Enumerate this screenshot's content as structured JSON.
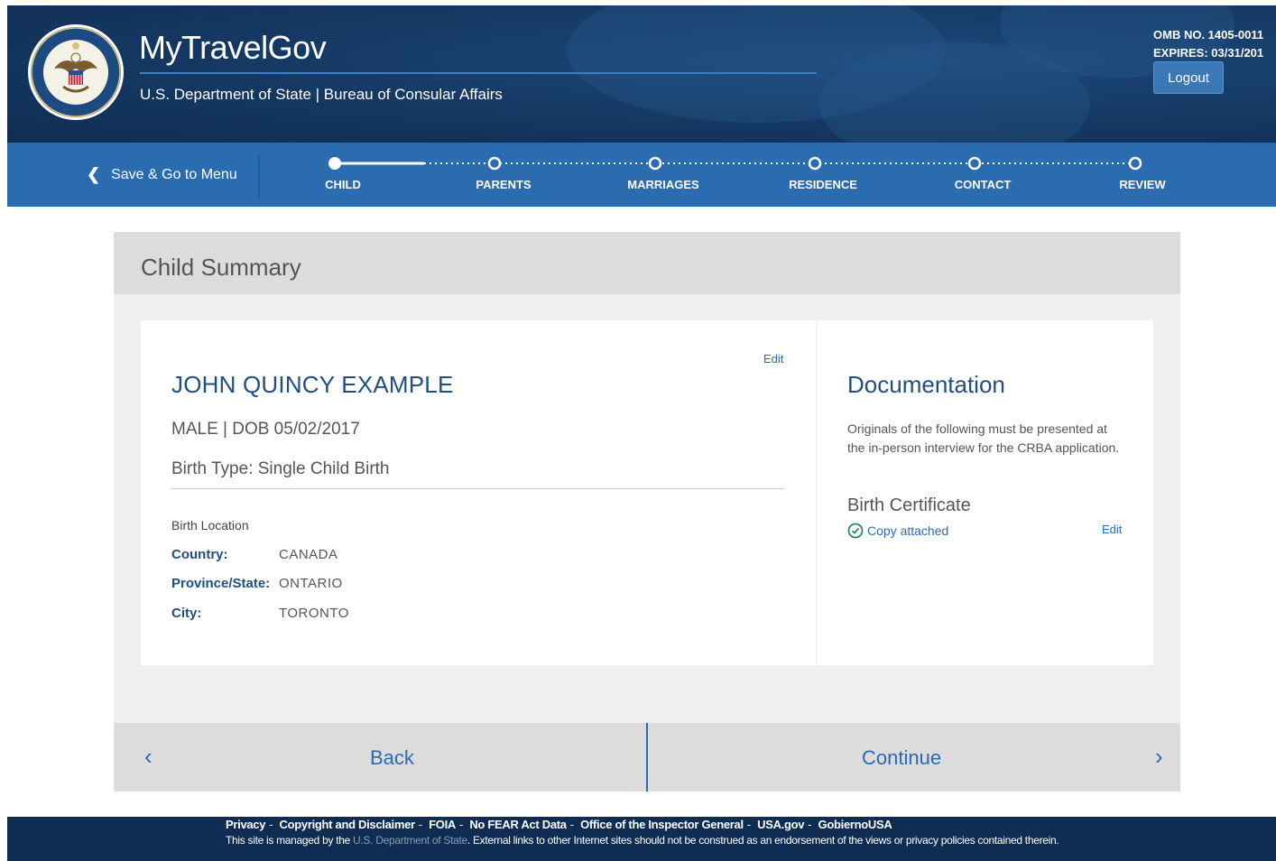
{
  "header": {
    "app_title": "MyTravelGov",
    "subtitle": "U.S. Department of State | Bureau of Consular Affairs",
    "seal_text": "DEPARTMENT OF STATE • UNITED STATES OF AMERICA",
    "omb_number": "OMB NO. 1405-0011",
    "expires": "EXPIRES: 03/31/201",
    "logout_label": "Logout"
  },
  "nav": {
    "save_menu_label": "Save & Go to Menu",
    "steps": [
      {
        "label": "CHILD",
        "state": "current"
      },
      {
        "label": "PARENTS",
        "state": "upcoming"
      },
      {
        "label": "MARRIAGES",
        "state": "upcoming"
      },
      {
        "label": "RESIDENCE",
        "state": "upcoming"
      },
      {
        "label": "CONTACT",
        "state": "upcoming"
      },
      {
        "label": "REVIEW",
        "state": "upcoming"
      }
    ]
  },
  "main": {
    "title": "Child Summary",
    "child": {
      "edit_label": "Edit",
      "name": "JOHN QUINCY EXAMPLE",
      "gender_dob": "MALE | DOB 05/02/2017",
      "birth_type": "Birth Type: Single Child Birth",
      "birth_location_heading": "Birth Location",
      "location": [
        {
          "label": "Country:",
          "value": "CANADA"
        },
        {
          "label": "Province/State:",
          "value": "ONTARIO"
        },
        {
          "label": "City:",
          "value": "TORONTO"
        }
      ]
    },
    "documentation": {
      "title": "Documentation",
      "description": "Originals of the following must be presented at the in-person interview for the CRBA application.",
      "birth_certificate_title": "Birth Certificate",
      "status": "Copy attached",
      "edit_label": "Edit"
    },
    "back_label": "Back",
    "continue_label": "Continue"
  },
  "footer": {
    "links": [
      "Privacy",
      "Copyright and Disclaimer",
      "FOIA",
      "No FEAR Act Data",
      "Office of the Inspector General",
      "USA.gov",
      "GobiernoUSA"
    ],
    "note_prefix": "This site is managed by the",
    "note_dos": "U.S. Department of State",
    "note_suffix": ". External links to other Internet sites should not be construed as an endorsement of the views or privacy policies contained therein."
  },
  "colors": {
    "header_bg": "#163b66",
    "nav_bg": "#2b6bb0",
    "accent": "#1f4f82",
    "success": "#2b6bb0"
  }
}
